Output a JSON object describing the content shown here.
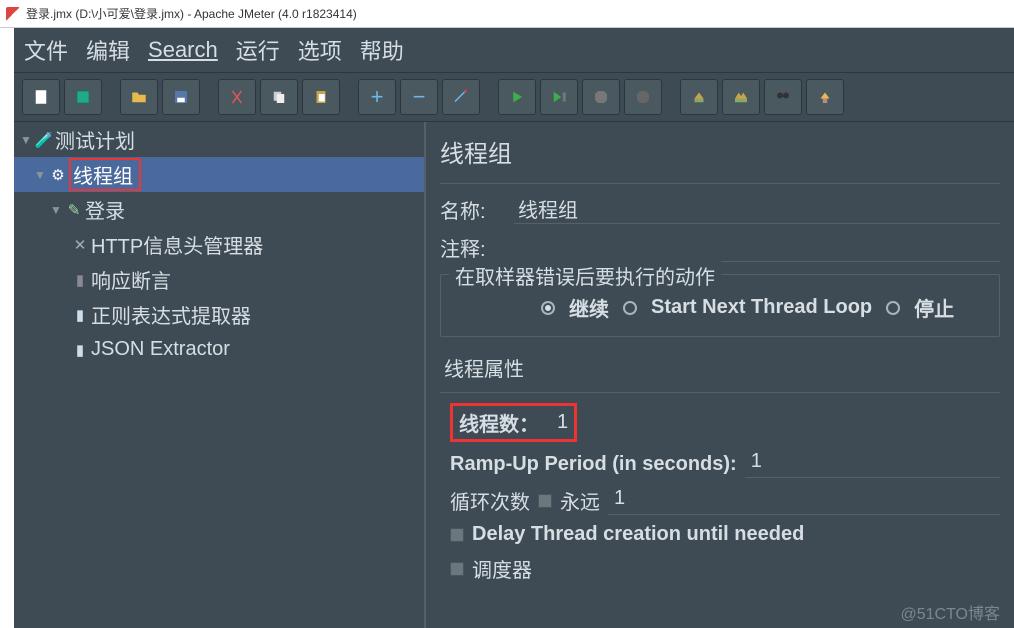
{
  "window": {
    "title": "登录.jmx (D:\\小可爱\\登录.jmx) - Apache JMeter (4.0 r1823414)"
  },
  "menu": {
    "file": "文件",
    "edit": "编辑",
    "search": "Search",
    "run": "运行",
    "options": "选项",
    "help": "帮助"
  },
  "tree": {
    "root": "测试计划",
    "thread_group": "线程组",
    "login": "登录",
    "http_header_mgr": "HTTP信息头管理器",
    "response_assert": "响应断言",
    "regex_extractor": "正则表达式提取器",
    "json_extractor": "JSON Extractor"
  },
  "panel": {
    "heading": "线程组",
    "name_label": "名称:",
    "name_value": "线程组",
    "comment_label": "注释:",
    "comment_value": "",
    "on_error_legend": "在取样器错误后要执行的动作",
    "radio_continue": "继续",
    "radio_next_loop": "Start Next Thread Loop",
    "radio_stop": "停止",
    "thread_props_title": "线程属性",
    "threads_label": "线程数：",
    "threads_value": "1",
    "rampup_label": "Ramp-Up Period (in seconds):",
    "rampup_value": "1",
    "loop_label": "循环次数",
    "forever_label": "永远",
    "loop_value": "1",
    "delay_label": "Delay Thread creation until needed",
    "scheduler_label": "调度器"
  },
  "watermark": "@51CTO博客"
}
